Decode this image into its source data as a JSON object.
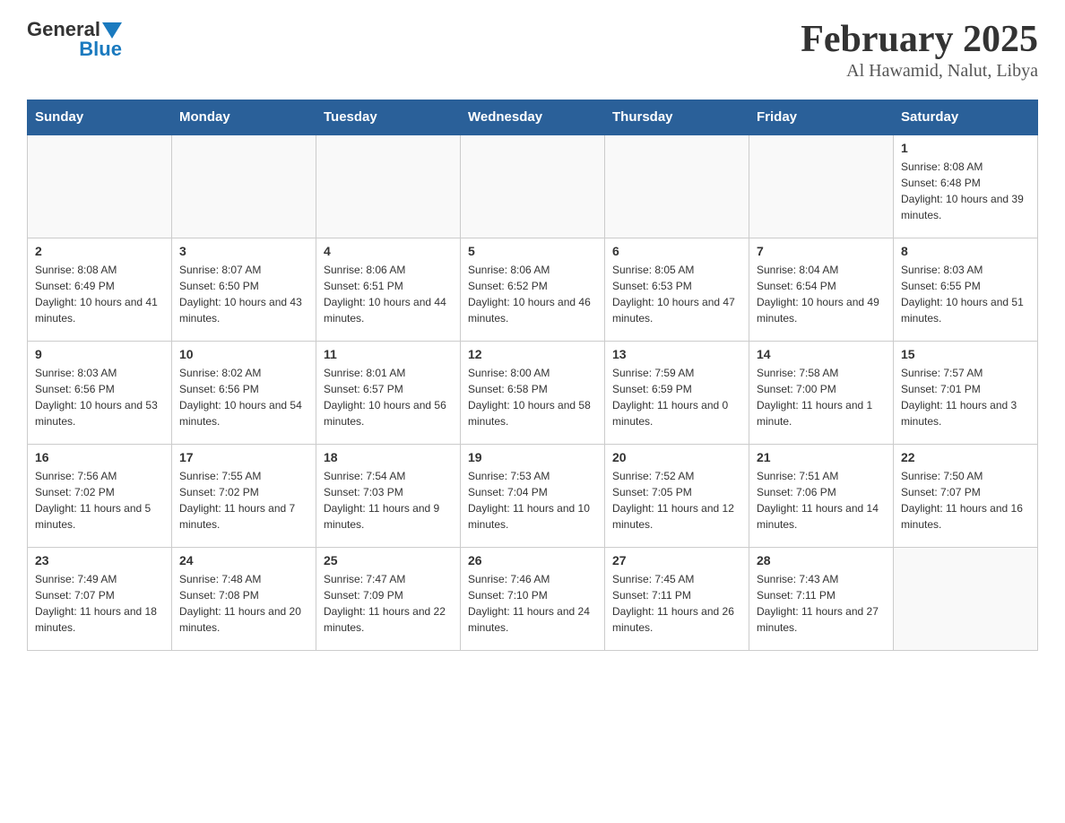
{
  "header": {
    "logo_general": "General",
    "logo_blue": "Blue",
    "title": "February 2025",
    "subtitle": "Al Hawamid, Nalut, Libya"
  },
  "weekdays": [
    "Sunday",
    "Monday",
    "Tuesday",
    "Wednesday",
    "Thursday",
    "Friday",
    "Saturday"
  ],
  "weeks": [
    [
      {
        "day": "",
        "sunrise": "",
        "sunset": "",
        "daylight": "",
        "empty": true
      },
      {
        "day": "",
        "sunrise": "",
        "sunset": "",
        "daylight": "",
        "empty": true
      },
      {
        "day": "",
        "sunrise": "",
        "sunset": "",
        "daylight": "",
        "empty": true
      },
      {
        "day": "",
        "sunrise": "",
        "sunset": "",
        "daylight": "",
        "empty": true
      },
      {
        "day": "",
        "sunrise": "",
        "sunset": "",
        "daylight": "",
        "empty": true
      },
      {
        "day": "",
        "sunrise": "",
        "sunset": "",
        "daylight": "",
        "empty": true
      },
      {
        "day": "1",
        "sunrise": "Sunrise: 8:08 AM",
        "sunset": "Sunset: 6:48 PM",
        "daylight": "Daylight: 10 hours and 39 minutes.",
        "empty": false
      }
    ],
    [
      {
        "day": "2",
        "sunrise": "Sunrise: 8:08 AM",
        "sunset": "Sunset: 6:49 PM",
        "daylight": "Daylight: 10 hours and 41 minutes.",
        "empty": false
      },
      {
        "day": "3",
        "sunrise": "Sunrise: 8:07 AM",
        "sunset": "Sunset: 6:50 PM",
        "daylight": "Daylight: 10 hours and 43 minutes.",
        "empty": false
      },
      {
        "day": "4",
        "sunrise": "Sunrise: 8:06 AM",
        "sunset": "Sunset: 6:51 PM",
        "daylight": "Daylight: 10 hours and 44 minutes.",
        "empty": false
      },
      {
        "day": "5",
        "sunrise": "Sunrise: 8:06 AM",
        "sunset": "Sunset: 6:52 PM",
        "daylight": "Daylight: 10 hours and 46 minutes.",
        "empty": false
      },
      {
        "day": "6",
        "sunrise": "Sunrise: 8:05 AM",
        "sunset": "Sunset: 6:53 PM",
        "daylight": "Daylight: 10 hours and 47 minutes.",
        "empty": false
      },
      {
        "day": "7",
        "sunrise": "Sunrise: 8:04 AM",
        "sunset": "Sunset: 6:54 PM",
        "daylight": "Daylight: 10 hours and 49 minutes.",
        "empty": false
      },
      {
        "day": "8",
        "sunrise": "Sunrise: 8:03 AM",
        "sunset": "Sunset: 6:55 PM",
        "daylight": "Daylight: 10 hours and 51 minutes.",
        "empty": false
      }
    ],
    [
      {
        "day": "9",
        "sunrise": "Sunrise: 8:03 AM",
        "sunset": "Sunset: 6:56 PM",
        "daylight": "Daylight: 10 hours and 53 minutes.",
        "empty": false
      },
      {
        "day": "10",
        "sunrise": "Sunrise: 8:02 AM",
        "sunset": "Sunset: 6:56 PM",
        "daylight": "Daylight: 10 hours and 54 minutes.",
        "empty": false
      },
      {
        "day": "11",
        "sunrise": "Sunrise: 8:01 AM",
        "sunset": "Sunset: 6:57 PM",
        "daylight": "Daylight: 10 hours and 56 minutes.",
        "empty": false
      },
      {
        "day": "12",
        "sunrise": "Sunrise: 8:00 AM",
        "sunset": "Sunset: 6:58 PM",
        "daylight": "Daylight: 10 hours and 58 minutes.",
        "empty": false
      },
      {
        "day": "13",
        "sunrise": "Sunrise: 7:59 AM",
        "sunset": "Sunset: 6:59 PM",
        "daylight": "Daylight: 11 hours and 0 minutes.",
        "empty": false
      },
      {
        "day": "14",
        "sunrise": "Sunrise: 7:58 AM",
        "sunset": "Sunset: 7:00 PM",
        "daylight": "Daylight: 11 hours and 1 minute.",
        "empty": false
      },
      {
        "day": "15",
        "sunrise": "Sunrise: 7:57 AM",
        "sunset": "Sunset: 7:01 PM",
        "daylight": "Daylight: 11 hours and 3 minutes.",
        "empty": false
      }
    ],
    [
      {
        "day": "16",
        "sunrise": "Sunrise: 7:56 AM",
        "sunset": "Sunset: 7:02 PM",
        "daylight": "Daylight: 11 hours and 5 minutes.",
        "empty": false
      },
      {
        "day": "17",
        "sunrise": "Sunrise: 7:55 AM",
        "sunset": "Sunset: 7:02 PM",
        "daylight": "Daylight: 11 hours and 7 minutes.",
        "empty": false
      },
      {
        "day": "18",
        "sunrise": "Sunrise: 7:54 AM",
        "sunset": "Sunset: 7:03 PM",
        "daylight": "Daylight: 11 hours and 9 minutes.",
        "empty": false
      },
      {
        "day": "19",
        "sunrise": "Sunrise: 7:53 AM",
        "sunset": "Sunset: 7:04 PM",
        "daylight": "Daylight: 11 hours and 10 minutes.",
        "empty": false
      },
      {
        "day": "20",
        "sunrise": "Sunrise: 7:52 AM",
        "sunset": "Sunset: 7:05 PM",
        "daylight": "Daylight: 11 hours and 12 minutes.",
        "empty": false
      },
      {
        "day": "21",
        "sunrise": "Sunrise: 7:51 AM",
        "sunset": "Sunset: 7:06 PM",
        "daylight": "Daylight: 11 hours and 14 minutes.",
        "empty": false
      },
      {
        "day": "22",
        "sunrise": "Sunrise: 7:50 AM",
        "sunset": "Sunset: 7:07 PM",
        "daylight": "Daylight: 11 hours and 16 minutes.",
        "empty": false
      }
    ],
    [
      {
        "day": "23",
        "sunrise": "Sunrise: 7:49 AM",
        "sunset": "Sunset: 7:07 PM",
        "daylight": "Daylight: 11 hours and 18 minutes.",
        "empty": false
      },
      {
        "day": "24",
        "sunrise": "Sunrise: 7:48 AM",
        "sunset": "Sunset: 7:08 PM",
        "daylight": "Daylight: 11 hours and 20 minutes.",
        "empty": false
      },
      {
        "day": "25",
        "sunrise": "Sunrise: 7:47 AM",
        "sunset": "Sunset: 7:09 PM",
        "daylight": "Daylight: 11 hours and 22 minutes.",
        "empty": false
      },
      {
        "day": "26",
        "sunrise": "Sunrise: 7:46 AM",
        "sunset": "Sunset: 7:10 PM",
        "daylight": "Daylight: 11 hours and 24 minutes.",
        "empty": false
      },
      {
        "day": "27",
        "sunrise": "Sunrise: 7:45 AM",
        "sunset": "Sunset: 7:11 PM",
        "daylight": "Daylight: 11 hours and 26 minutes.",
        "empty": false
      },
      {
        "day": "28",
        "sunrise": "Sunrise: 7:43 AM",
        "sunset": "Sunset: 7:11 PM",
        "daylight": "Daylight: 11 hours and 27 minutes.",
        "empty": false
      },
      {
        "day": "",
        "sunrise": "",
        "sunset": "",
        "daylight": "",
        "empty": true
      }
    ]
  ]
}
